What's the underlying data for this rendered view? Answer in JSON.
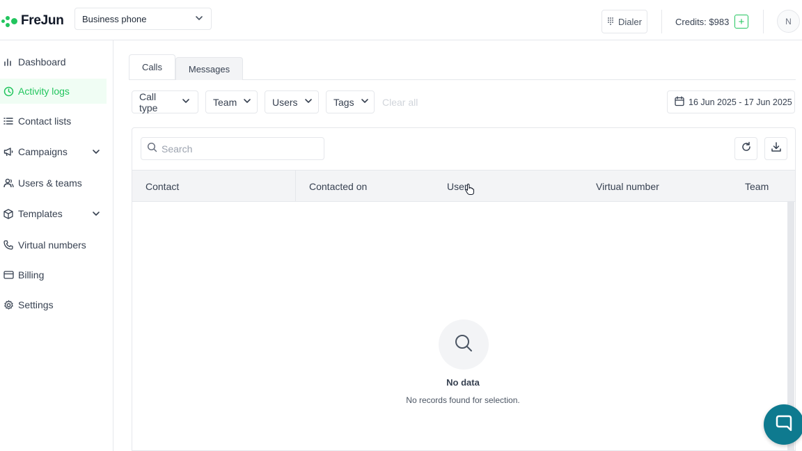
{
  "header": {
    "logo_text": "FreJun",
    "business_select": "Business phone",
    "dialer_label": "Dialer",
    "credits_label": "Credits: $983",
    "plus_label": "+",
    "avatar_initial": "N"
  },
  "sidebar": {
    "items": [
      {
        "label": "Dashboard",
        "icon": "bar-chart-icon"
      },
      {
        "label": "Activity logs",
        "icon": "clock-icon",
        "active": true
      },
      {
        "label": "Contact lists",
        "icon": "list-icon"
      },
      {
        "label": "Campaigns",
        "icon": "megaphone-icon",
        "expandable": true
      },
      {
        "label": "Users & teams",
        "icon": "users-icon"
      },
      {
        "label": "Templates",
        "icon": "cube-icon",
        "expandable": true
      },
      {
        "label": "Virtual numbers",
        "icon": "phone-icon"
      },
      {
        "label": "Billing",
        "icon": "credit-card-icon"
      },
      {
        "label": "Settings",
        "icon": "gear-icon"
      }
    ]
  },
  "tabs": {
    "calls": "Calls",
    "messages": "Messages"
  },
  "filters": {
    "call_type": "Call type",
    "team": "Team",
    "users": "Users",
    "tags": "Tags",
    "clear_all": "Clear all",
    "date_range": "16 Jun 2025 - 17 Jun 2025"
  },
  "search": {
    "placeholder": "Search",
    "value": ""
  },
  "table": {
    "columns": [
      "Contact",
      "Contacted on",
      "User",
      "Virtual number",
      "Team"
    ],
    "rows": []
  },
  "empty_state": {
    "title": "No data",
    "subtitle": "No records found for selection."
  },
  "colors": {
    "accent": "#22c55e",
    "active_bg": "#f0fdf4",
    "chat_button": "#0e7a8f"
  }
}
